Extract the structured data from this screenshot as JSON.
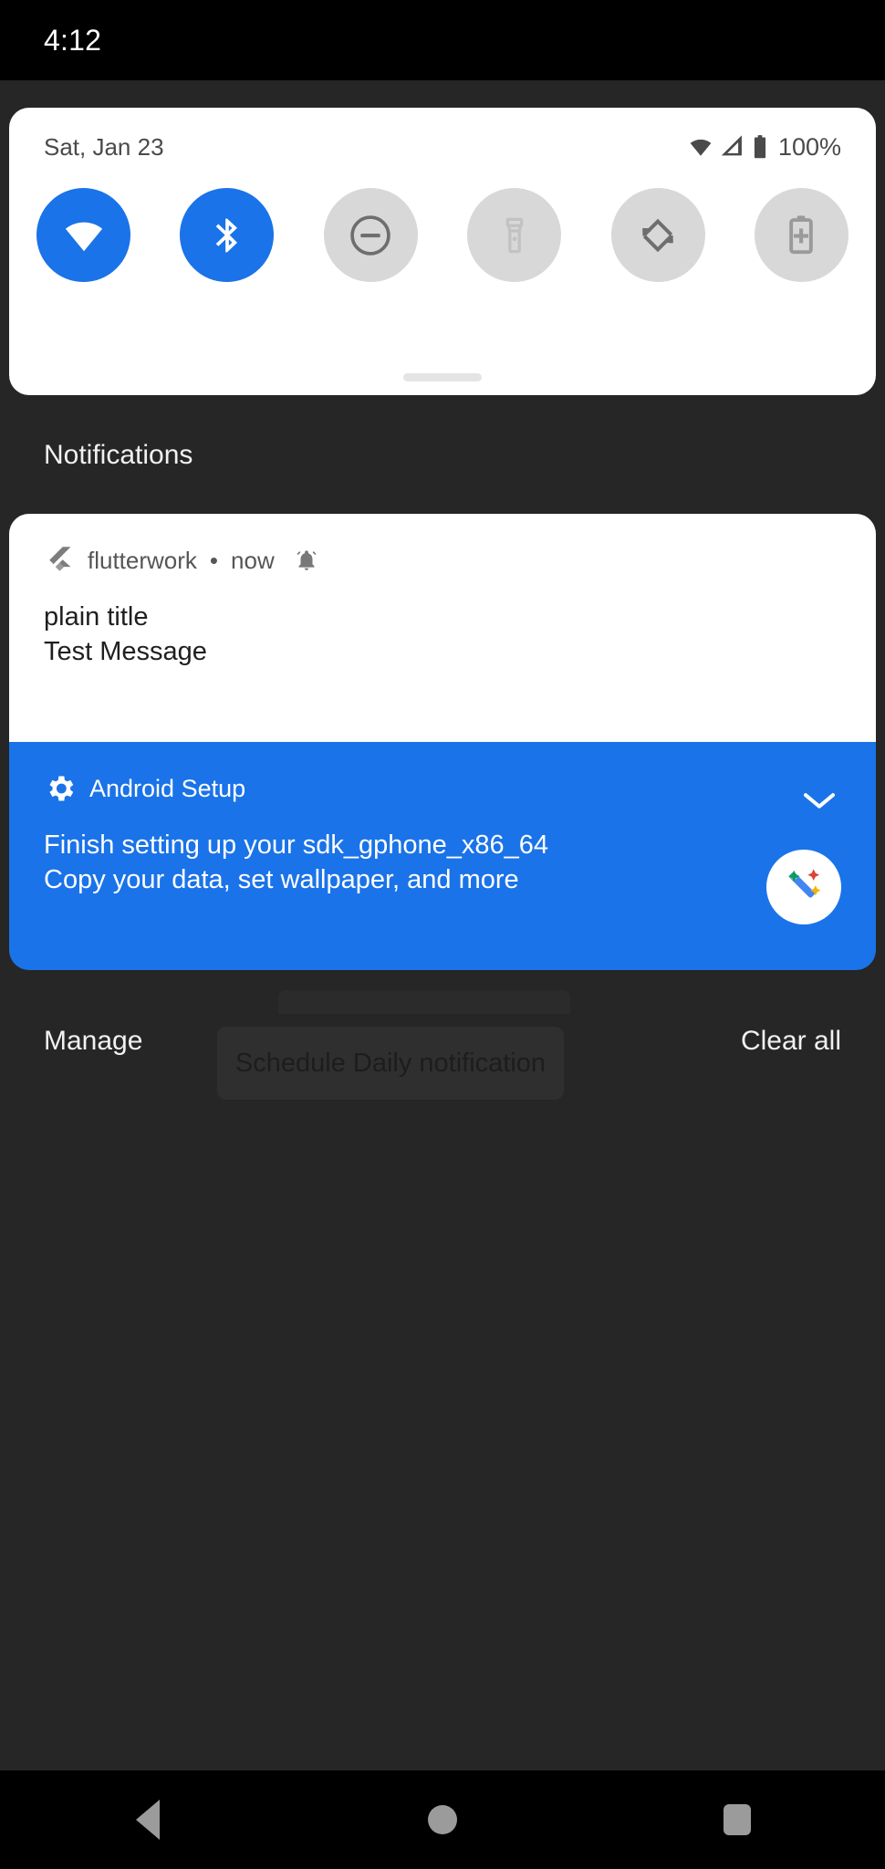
{
  "statusbar": {
    "clock": "4:12"
  },
  "quick_settings": {
    "date": "Sat, Jan 23",
    "battery_percent": "100%",
    "icons": [
      "wifi-status-icon",
      "cell-signal-icon",
      "battery-icon"
    ],
    "tiles": [
      {
        "name": "wifi",
        "icon": "wifi-icon",
        "state": "on"
      },
      {
        "name": "bluetooth",
        "icon": "bluetooth-icon",
        "state": "on"
      },
      {
        "name": "do-not-disturb",
        "icon": "do-not-disturb-icon",
        "state": "off"
      },
      {
        "name": "flashlight",
        "icon": "flashlight-icon",
        "state": "off"
      },
      {
        "name": "auto-rotate",
        "icon": "auto-rotate-icon",
        "state": "off"
      },
      {
        "name": "battery-saver",
        "icon": "battery-saver-icon",
        "state": "off"
      }
    ],
    "accent_on": "#1a73e8",
    "tile_off_bg": "#d8d8d8"
  },
  "section": {
    "notifications_label": "Notifications"
  },
  "notifications": [
    {
      "app_name": "flutterwork",
      "separator": "•",
      "time": "now",
      "alert_icon": "bell-ringing-icon",
      "app_icon": "flutter-logo-icon",
      "title": "plain title",
      "text": "Test Message",
      "style": "plain",
      "bg": "#ffffff"
    },
    {
      "app_name": "Android Setup",
      "app_icon": "gear-icon",
      "title": "Finish setting up your sdk_gphone_x86_64",
      "text": "Copy your data, set wallpaper, and more",
      "style": "setup",
      "bg": "#1a73e8",
      "expand_icon": "chevron-down-icon",
      "large_icon": "magic-wand-icon"
    }
  ],
  "footer": {
    "manage_label": "Manage",
    "clear_all_label": "Clear all"
  },
  "background_app": {
    "button_label": "Schedule Daily notification"
  },
  "navbar": {
    "back": "back-icon",
    "home": "home-icon",
    "recents": "recents-icon"
  }
}
